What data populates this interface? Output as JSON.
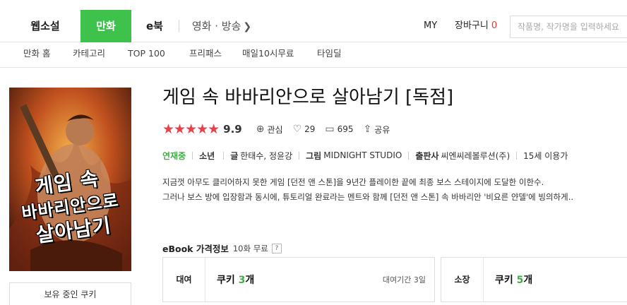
{
  "topnav": {
    "tabs": [
      {
        "label": "웹소설",
        "active": false
      },
      {
        "label": "만화",
        "active": true
      },
      {
        "label": "e북",
        "active": false
      },
      {
        "label": "영화 · 방송",
        "active": false
      }
    ],
    "my_label": "MY",
    "cart_label": "장바구니",
    "cart_count": "0",
    "search_placeholder": "작품명, 작가명을 입력하세요",
    "active_color": "#3fc24b"
  },
  "subnav": {
    "items": [
      "만화 홈",
      "카테고리",
      "TOP 100",
      "프리패스",
      "매일10시무료",
      "타임딜"
    ]
  },
  "book": {
    "cover_text": [
      "게임 속",
      "바바리안으로",
      "살아남기"
    ],
    "title": "게임 속 바바리안으로 살아남기 [독점]",
    "rating_stars": 5,
    "rating": "9.9",
    "interest_label": "관심",
    "likes": "29",
    "comments": "695",
    "share_label": "공유",
    "status": "연재중",
    "category": "소년",
    "writer_label": "글",
    "writer": "한태수, 정윤강",
    "artist_label": "그림",
    "artist": "MIDNIGHT STUDIO",
    "publisher_label": "출판사",
    "publisher": "씨엔씨레볼루션(주)",
    "age": "15세 이용가",
    "description_lines": [
      "지금껏 아무도 클리어하지 못한 게임 [던전 앤 스톤]을 9년간 플레이한 끝에 최종 보스 스테이지에 도달한 이한수.",
      "그러나 보스 방에 입장함과 동시에, 튜토리얼 완료라는 멘트와 함께 [던전 앤 스톤] 속 바바리안 '비요른 얀델'에 빙의하게.."
    ],
    "owned_cookie_label": "보유 중인 쿠키"
  },
  "price": {
    "label": "eBook 가격정보",
    "free_info": "10화 무료",
    "help": "?",
    "rent": {
      "kind": "대여",
      "prefix": "쿠키 ",
      "count": "3",
      "suffix": "개",
      "period": "대여기간 3일"
    },
    "own": {
      "kind": "소장",
      "prefix": "쿠키 ",
      "count": "5",
      "suffix": "개"
    }
  }
}
